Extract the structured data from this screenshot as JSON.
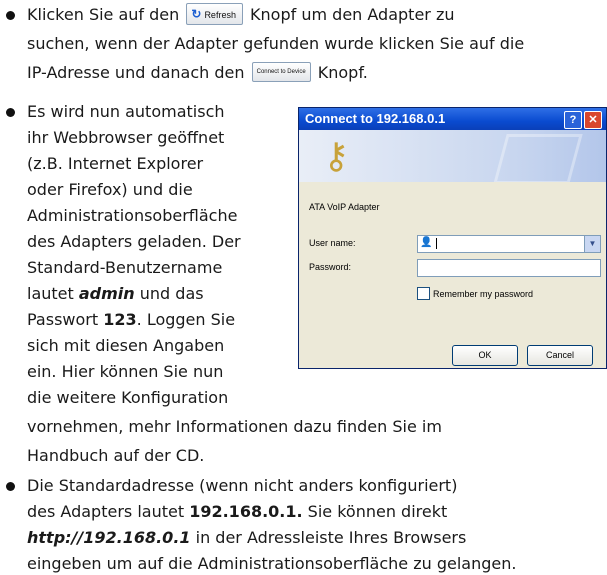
{
  "bullet1": {
    "line1_before": "Klicken Sie auf den",
    "refresh_label": "Refresh",
    "refresh_icon": "refresh-icon",
    "line1_after": "Knopf um den Adapter zu",
    "line2": "suchen, wenn der Adapter gefunden wurde klicken Sie auf die",
    "line3_before": "IP-Adresse und danach den",
    "connect_label": "Connect to Device",
    "line3_after": "Knopf."
  },
  "bullet2": {
    "lines_narrow": [
      "Es wird nun automatisch",
      "ihr Webbrowser geöffnet",
      "(z.B. Internet Explorer",
      "oder Firefox) und die",
      "Administrationsoberfläche",
      "des Adapters geladen. Der",
      "Standard-Benutzername"
    ],
    "line_admin_before": "lautet",
    "admin_value": "admin",
    "line_admin_after": "und das",
    "line_pw_before": "Passwort",
    "password_value": "123",
    "line_pw_after": ". Loggen Sie",
    "lines_narrow_end": [
      "sich mit diesen Angaben",
      "ein. Hier können Sie nun",
      "die weitere Konfiguration"
    ],
    "lines_wide": [
      "vornehmen, mehr Informationen dazu finden Sie im",
      "Handbuch auf der CD."
    ]
  },
  "dialog": {
    "title": "Connect to 192.168.0.1",
    "help_glyph": "?",
    "close_glyph": "✕",
    "realm": "ATA VoIP Adapter",
    "username_label": "User name:",
    "password_label": "Password:",
    "remember_label": "Remember my password",
    "ok_label": "OK",
    "cancel_label": "Cancel"
  },
  "bullet3": {
    "line1": "Die Standardadresse (wenn nicht anders konfiguriert)",
    "line2_before": "des Adapters lautet",
    "address_value": "192.168.0.1.",
    "line2_after": "Sie können direkt",
    "url_value": "http://192.168.0.1",
    "line3_after": "in der Adressleiste Ihres Browsers",
    "line4": "eingeben um auf die Administrationsoberfläche zu gelangen."
  }
}
